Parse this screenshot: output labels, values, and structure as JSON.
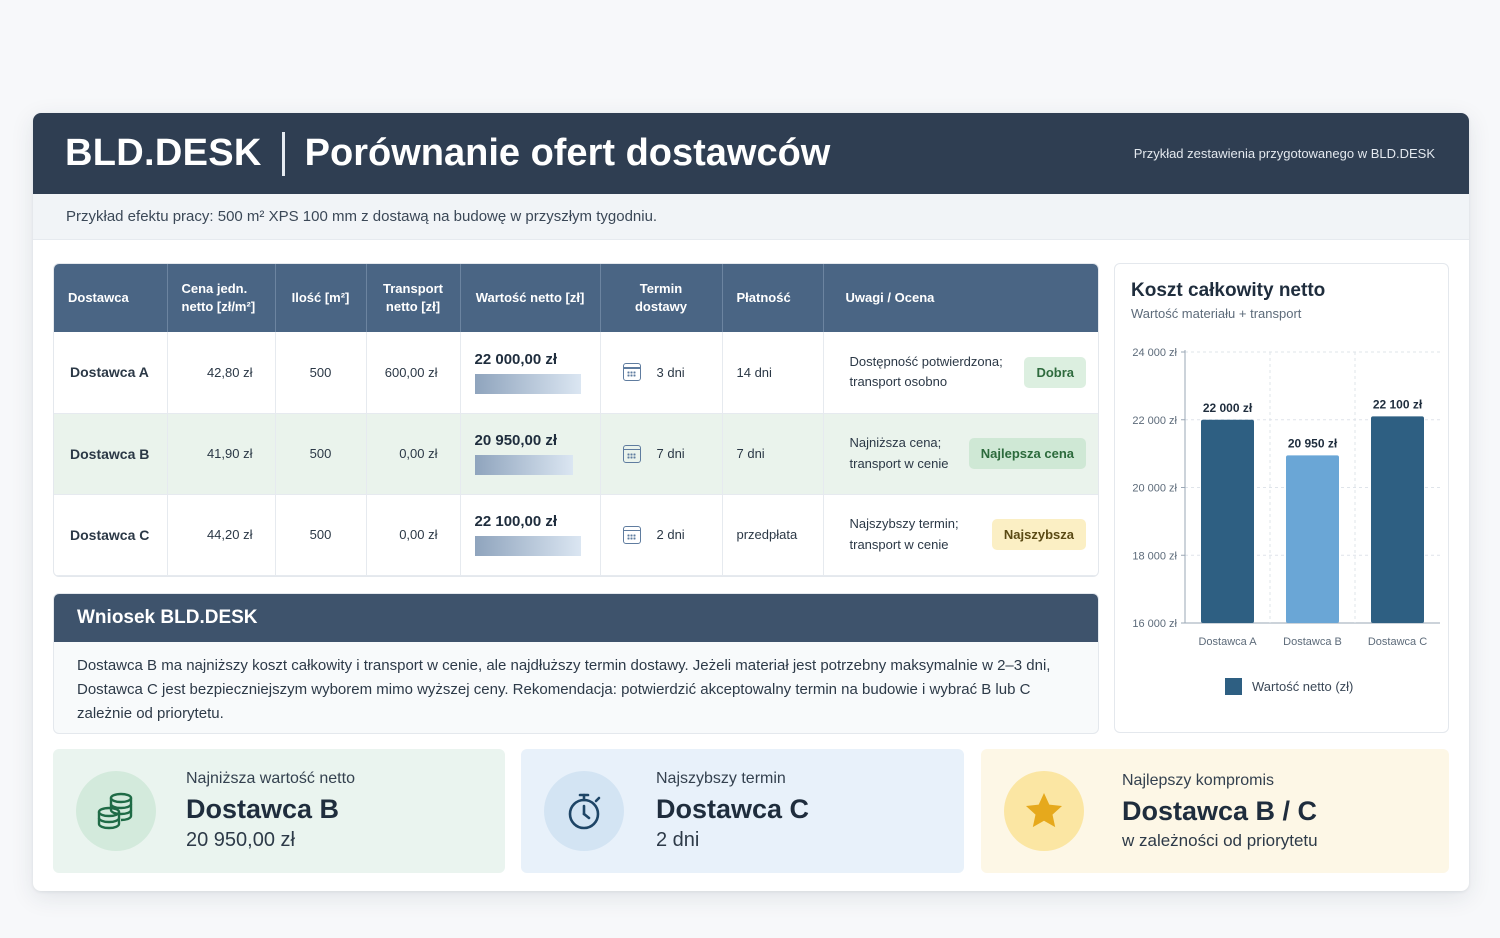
{
  "header": {
    "brand": "BLD.DESK",
    "title": "Porównanie ofert dostawców",
    "note": "Przykład zestawienia przygotowanego w BLD.DESK"
  },
  "subtitle": "Przykład efektu pracy: 500 m² XPS 100 mm z dostawą na budowę w przyszłym tygodniu.",
  "table": {
    "columns": [
      "Dostawca",
      "Cena jedn. netto [zł/m²]",
      "Ilość [m²]",
      "Transport netto [zł]",
      "Wartość netto [zł]",
      "Termin dostawy",
      "Płatność",
      "Uwagi / Ocena"
    ],
    "rows": [
      {
        "supplier": "Dostawca A",
        "price": "42,80 zł",
        "qty": "500",
        "transport": "600,00 zł",
        "value": "22 000,00 zł",
        "term": "3 dni",
        "payment": "14 dni",
        "note": "Dostępność potwierdzona; transport osobno",
        "badge": "Dobra"
      },
      {
        "supplier": "Dostawca B",
        "price": "41,90 zł",
        "qty": "500",
        "transport": "0,00 zł",
        "value": "20 950,00 zł",
        "term": "7 dni",
        "payment": "7 dni",
        "note": "Najniższa cena; transport w cenie",
        "badge": "Najlepsza cena"
      },
      {
        "supplier": "Dostawca C",
        "price": "44,20 zł",
        "qty": "500",
        "transport": "0,00 zł",
        "value": "22 100,00 zł",
        "term": "2 dni",
        "payment": "przedpłata",
        "note": "Najszybszy termin; transport w cenie",
        "badge": "Najszybsza"
      }
    ]
  },
  "conclusion": {
    "title": "Wniosek BLD.DESK",
    "text": "Dostawca B ma najniższy koszt całkowity i transport w cenie, ale najdłuższy termin dostawy. Jeżeli materiał jest potrzebny maksymalnie w 2–3 dni, Dostawca C jest bezpieczniejszym wyborem mimo wyższej ceny. Rekomendacja: potwierdzić akceptowalny termin na budowie i wybrać B lub C zależnie od priorytetu."
  },
  "chart_data": {
    "type": "bar",
    "title": "Koszt całkowity netto",
    "subtitle": "Wartość materiału + transport",
    "categories": [
      "Dostawca A",
      "Dostawca B",
      "Dostawca C"
    ],
    "series": [
      {
        "name": "Wartość netto (zł)",
        "values": [
          22000,
          20950,
          22100
        ]
      }
    ],
    "data_labels": [
      "22 000 zł",
      "20 950 zł",
      "22 100 zł"
    ],
    "yticks": [
      "16 000 zł",
      "18 000 zł",
      "20 000 zł",
      "22 000 zł",
      "24 000 zł"
    ],
    "ylim": [
      16000,
      24000
    ],
    "colors": [
      "#2e5f82",
      "#6aa6d6",
      "#2e5f82"
    ],
    "grid": true,
    "legend": "bottom"
  },
  "kpis": [
    {
      "label": "Najniższa wartość netto",
      "value": "Dostawca B",
      "sub": "20 950,00 zł",
      "icon": "coins-icon"
    },
    {
      "label": "Najszybszy termin",
      "value": "Dostawca C",
      "sub": "2 dni",
      "icon": "stopwatch-icon"
    },
    {
      "label": "Najlepszy kompromis",
      "value": "Dostawca B / C",
      "sub": "w zależności od priorytetu",
      "icon": "star-icon"
    }
  ]
}
